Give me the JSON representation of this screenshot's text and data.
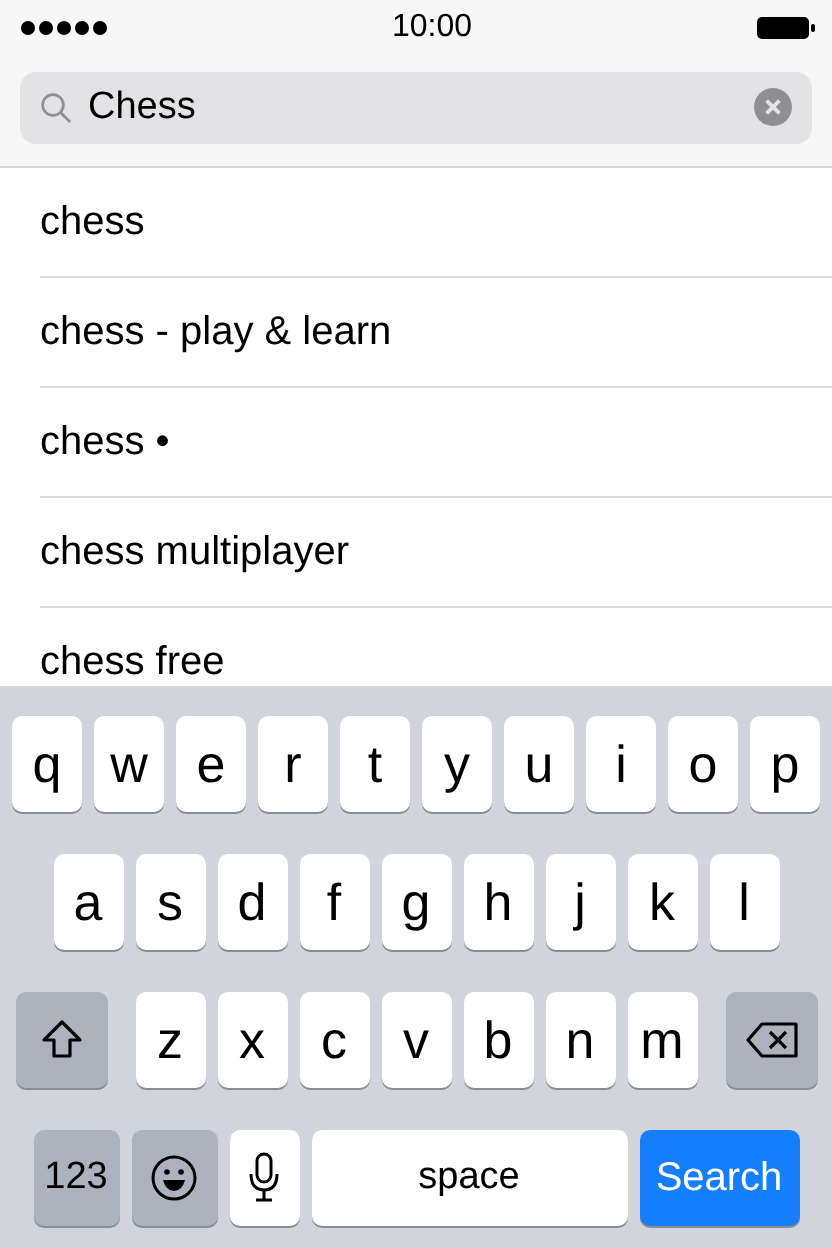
{
  "status_bar": {
    "time": "10:00"
  },
  "search": {
    "value": "Chess"
  },
  "suggestions": [
    "chess",
    "chess - play & learn",
    "chess •",
    "chess multiplayer",
    "chess free"
  ],
  "keyboard": {
    "rows": [
      {
        "keys": [
          {
            "kind": "letter",
            "label": "q"
          },
          {
            "kind": "letter",
            "label": "w"
          },
          {
            "kind": "letter",
            "label": "e"
          },
          {
            "kind": "letter",
            "label": "r"
          },
          {
            "kind": "letter",
            "label": "t"
          },
          {
            "kind": "letter",
            "label": "y"
          },
          {
            "kind": "letter",
            "label": "u"
          },
          {
            "kind": "letter",
            "label": "i"
          },
          {
            "kind": "letter",
            "label": "o"
          },
          {
            "kind": "letter",
            "label": "p"
          }
        ]
      },
      {
        "keys": [
          {
            "kind": "letter",
            "label": "a"
          },
          {
            "kind": "letter",
            "label": "s"
          },
          {
            "kind": "letter",
            "label": "d"
          },
          {
            "kind": "letter",
            "label": "f"
          },
          {
            "kind": "letter",
            "label": "g"
          },
          {
            "kind": "letter",
            "label": "h"
          },
          {
            "kind": "letter",
            "label": "j"
          },
          {
            "kind": "letter",
            "label": "k"
          },
          {
            "kind": "letter",
            "label": "l"
          }
        ]
      },
      {
        "keys": [
          {
            "kind": "shift"
          },
          {
            "kind": "letter",
            "label": "z"
          },
          {
            "kind": "letter",
            "label": "x"
          },
          {
            "kind": "letter",
            "label": "c"
          },
          {
            "kind": "letter",
            "label": "v"
          },
          {
            "kind": "letter",
            "label": "b"
          },
          {
            "kind": "letter",
            "label": "n"
          },
          {
            "kind": "letter",
            "label": "m"
          },
          {
            "kind": "delete"
          }
        ]
      },
      {
        "keys": [
          {
            "kind": "numbers",
            "label": "123"
          },
          {
            "kind": "emoji"
          },
          {
            "kind": "mic"
          },
          {
            "kind": "space",
            "label": "space"
          },
          {
            "kind": "search",
            "label": "Search"
          }
        ]
      }
    ]
  }
}
